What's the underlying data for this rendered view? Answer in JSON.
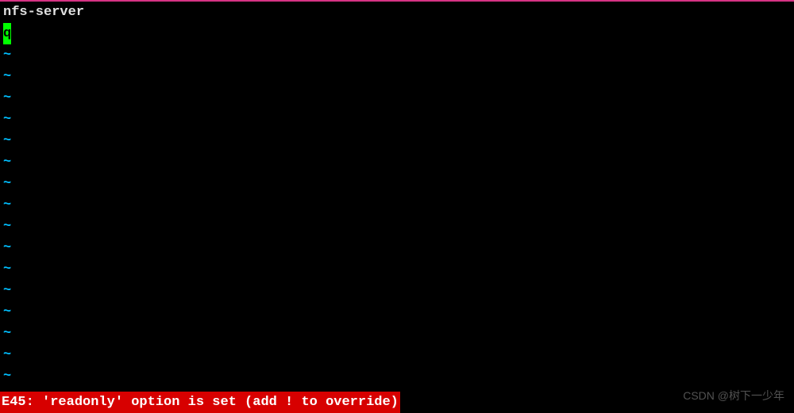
{
  "editor": {
    "line1": "nfs-server",
    "line2_char": "q",
    "tilde_char": "~",
    "tilde_count": 16
  },
  "status": {
    "error": "E45: 'readonly' option is set (add ! to override)"
  },
  "watermark": {
    "text": "CSDN @树下一少年"
  }
}
